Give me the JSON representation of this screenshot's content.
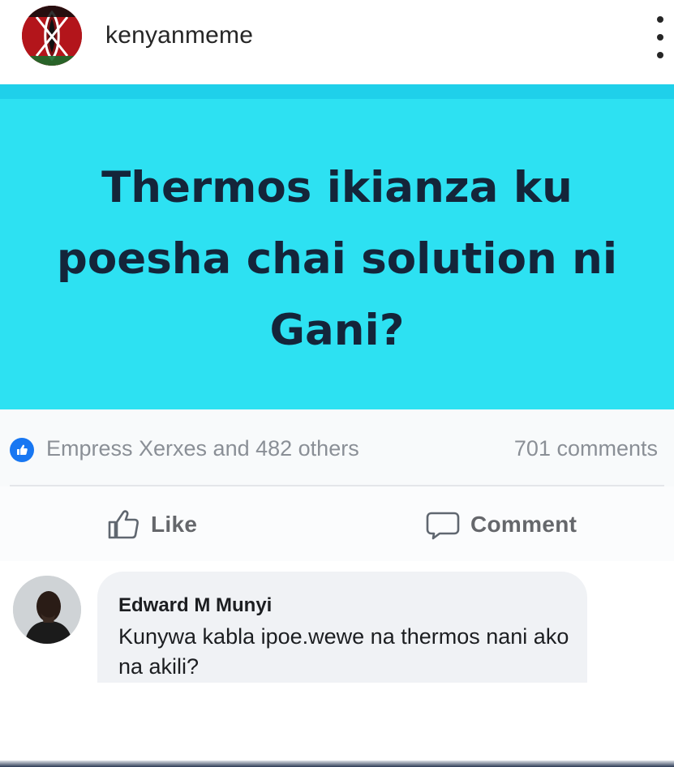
{
  "header": {
    "username": "kenyanmeme",
    "more_icon": "more-vertical-icon"
  },
  "post": {
    "banner_text": "Thermos ikianza ku poesha chai solution ni Gani?",
    "banner_color": "#2de1f2",
    "text_color": "#14253a",
    "reactions_text": "Empress Xerxes and 482 others",
    "comments_count": "701 comments",
    "actions": {
      "like_label": "Like",
      "comment_label": "Comment"
    },
    "comment": {
      "author": "Edward M Munyi",
      "text": "Kunywa kabla ipoe.wewe na thermos nani ako na akili?"
    }
  },
  "colors": {
    "facebook_blue": "#1877f2",
    "muted_text": "#8a8f96"
  }
}
